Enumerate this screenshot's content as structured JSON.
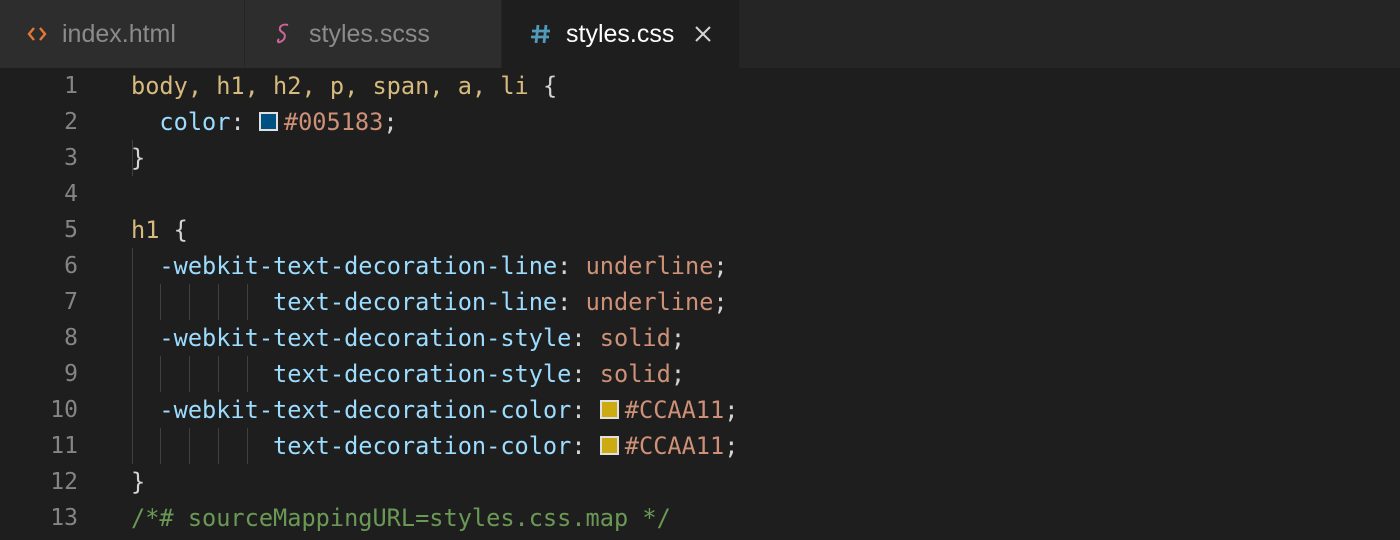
{
  "tabs": [
    {
      "label": "index.html",
      "icon": "html-brackets-icon",
      "icon_color": "#e37933",
      "active": false
    },
    {
      "label": "styles.scss",
      "icon": "sass-icon",
      "icon_color": "#cd6799",
      "active": false
    },
    {
      "label": "styles.css",
      "icon": "hash-icon",
      "icon_color": "#519aba",
      "active": true
    }
  ],
  "close_glyph": "×",
  "colors": {
    "selector": "#d7ba7d",
    "property": "#9cdcfe",
    "value": "#ce9178",
    "comment": "#6a9955",
    "swatch_blue": "#005183",
    "swatch_gold": "#CCAA11"
  },
  "lines": [
    {
      "n": "1",
      "sel": "body, h1, h2, p, span, a, li",
      "brace": " {"
    },
    {
      "n": "2",
      "indent": "  ",
      "prop": "color",
      "val": "#005183"
    },
    {
      "n": "3",
      "close": "}"
    },
    {
      "n": "4"
    },
    {
      "n": "5",
      "sel": "h1",
      "brace": " {"
    },
    {
      "n": "6",
      "indent": "  ",
      "prop": "-webkit-text-decoration-line",
      "val": "underline"
    },
    {
      "n": "7",
      "indent": "          ",
      "prop": "text-decoration-line",
      "val": "underline"
    },
    {
      "n": "8",
      "indent": "  ",
      "prop": "-webkit-text-decoration-style",
      "val": "solid"
    },
    {
      "n": "9",
      "indent": "          ",
      "prop": "text-decoration-style",
      "val": "solid"
    },
    {
      "n": "10",
      "indent": "  ",
      "prop": "-webkit-text-decoration-color",
      "val": "#CCAA11"
    },
    {
      "n": "11",
      "indent": "          ",
      "prop": "text-decoration-color",
      "val": "#CCAA11"
    },
    {
      "n": "12",
      "close": "}"
    },
    {
      "n": "13",
      "comment": "/*# sourceMappingURL=styles.css.map */"
    }
  ]
}
